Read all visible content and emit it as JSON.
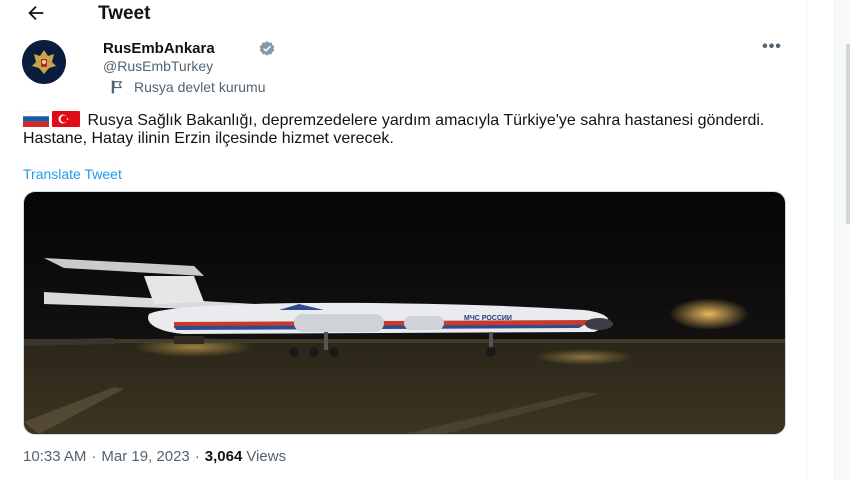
{
  "header": {
    "back_icon": "arrow-left-icon",
    "title": "Tweet"
  },
  "author": {
    "name": "RusEmbAnkara",
    "handle": "@RusEmbTurkey",
    "affiliation_label": "Rusya devlet kurumu",
    "verified_color": "#829aab",
    "avatar_color": "#0b1d3e"
  },
  "more_label": "•••",
  "tweet": {
    "text": "Rusya Sağlık Bakanlığı, depremzedelere yardım amacıyla Türkiye'ye sahra hastanesi gönderdi. Hastane, Hatay ilinin Erzin ilçesinde hizmet verecek.",
    "translate_label": "Translate Tweet",
    "plane_text": "МЧС РОССИИ"
  },
  "meta": {
    "time": "10:33 AM",
    "separator": "·",
    "date": "Mar 19, 2023",
    "views_count": "3,064",
    "views_label": "Views"
  },
  "colors": {
    "accent": "#1d9bf0",
    "secondary_text": "#536471",
    "primary_text": "#0f1419"
  }
}
